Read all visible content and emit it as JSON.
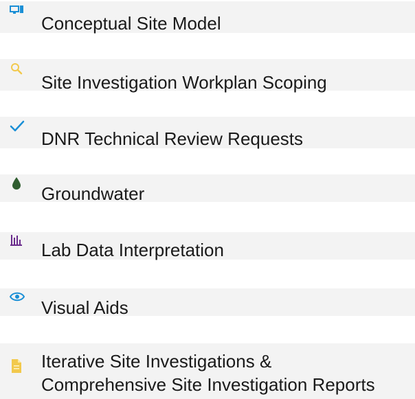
{
  "items": [
    {
      "label": "Conceptual Site Model",
      "icon": "computer-icon",
      "icon_color": "#1a8fd6"
    },
    {
      "label": "Site Investigation Workplan Scoping",
      "icon": "search-icon",
      "icon_color": "#f2c94c"
    },
    {
      "label": "DNR Technical Review Requests",
      "icon": "checkmark-icon",
      "icon_color": "#1a8fd6"
    },
    {
      "label": "Groundwater",
      "icon": "water-drop-icon",
      "icon_color": "#2f5d2f"
    },
    {
      "label": "Lab Data Interpretation",
      "icon": "bar-chart-icon",
      "icon_color": "#6a2c8c"
    },
    {
      "label": "Visual Aids",
      "icon": "eye-icon",
      "icon_color": "#1a8fd6"
    },
    {
      "label_line1": "Iterative Site Investigations &",
      "label_line2": "Comprehensive Site Investigation Reports",
      "icon": "document-icon",
      "icon_color": "#f2c94c"
    }
  ]
}
